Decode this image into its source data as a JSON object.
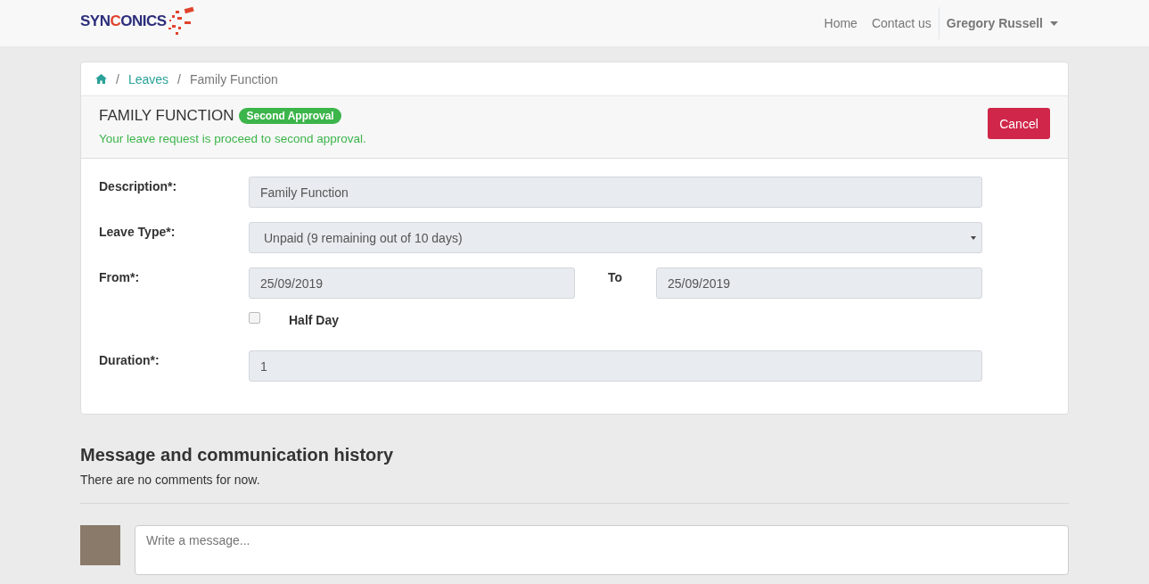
{
  "navbar": {
    "logo": [
      {
        "text": "SYN",
        "color": "#2d2f7c"
      },
      {
        "text": "C",
        "color": "#e0432e"
      },
      {
        "text": "ONICS",
        "color": "#2d2f7c"
      }
    ],
    "links": [
      "Home",
      "Contact us"
    ],
    "user": "Gregory Russell"
  },
  "breadcrumb": {
    "separator": "/",
    "items": [
      {
        "label": "Leaves",
        "link": true
      },
      {
        "label": "Family Function",
        "link": false
      }
    ]
  },
  "request": {
    "title": "FAMILY FUNCTION",
    "status": "Second Approval",
    "message": "Your leave request is proceed to second approval.",
    "cancel": "Cancel"
  },
  "form": {
    "description": {
      "label": "Description*:",
      "value": "Family Function"
    },
    "leave_type": {
      "label": "Leave Type*:",
      "value": "Unpaid (9 remaining out of 10 days)"
    },
    "from": {
      "label": "From*:",
      "value": "25/09/2019"
    },
    "to": {
      "label": "To",
      "value": "25/09/2019"
    },
    "half_day": {
      "label": "Half Day",
      "checked": false
    },
    "duration": {
      "label": "Duration*:",
      "value": "1"
    }
  },
  "history": {
    "title": "Message and communication history",
    "empty": "There are no comments for now.",
    "placeholder": "Write a message..."
  }
}
